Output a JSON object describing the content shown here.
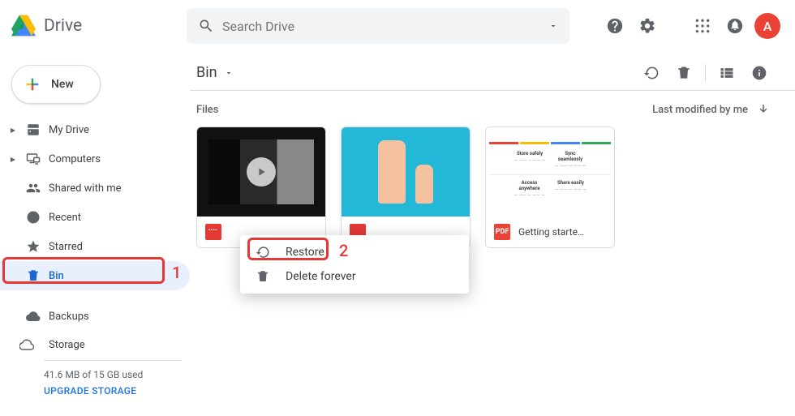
{
  "app": {
    "name": "Drive"
  },
  "search": {
    "placeholder": "Search Drive"
  },
  "avatar": {
    "initial": "A"
  },
  "new_button": {
    "label": "New"
  },
  "sidebar": {
    "items": [
      {
        "label": "My Drive"
      },
      {
        "label": "Computers"
      },
      {
        "label": "Shared with me"
      },
      {
        "label": "Recent"
      },
      {
        "label": "Starred"
      },
      {
        "label": "Bin"
      },
      {
        "label": "Backups"
      }
    ]
  },
  "storage": {
    "label": "Storage",
    "used_text": "41.6 MB of 15 GB used",
    "upgrade_text": "UPGRADE STORAGE"
  },
  "location": {
    "title": "Bin"
  },
  "section": {
    "files_label": "Files",
    "sort_label": "Last modified by me"
  },
  "files": [
    {
      "name": "",
      "badge": "vid"
    },
    {
      "name": "",
      "badge": "vid"
    },
    {
      "name": "Getting starte…",
      "badge": "pdf",
      "badge_text": "PDF"
    }
  ],
  "context_menu": {
    "items": [
      {
        "label": "Restore"
      },
      {
        "label": "Delete forever"
      }
    ]
  },
  "annotations": {
    "one": "1",
    "two": "2"
  }
}
